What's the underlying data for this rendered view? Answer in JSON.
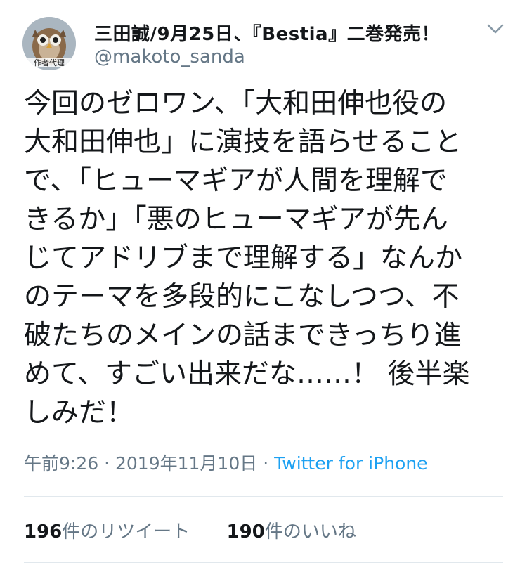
{
  "tweet": {
    "display_name": "三田誠/9月25日、『Bestia』二巻発売！",
    "handle": "@makoto_sanda",
    "avatar_caption": "作者代理",
    "text": "今回のゼロワン、「大和田伸也役の\n大和田伸也」に演技を語らせること\nで、「ヒューマギアが人間を理解で\nきるか」「悪のヒューマギアが先ん\nじてアドリブまで理解する」なんか\nのテーマを多段的にこなしつつ、不\n破たちのメインの話まできっちり進\nめて、すごい出来だな……！ 後半楽\nしみだ！",
    "time": "午前9:26",
    "separator": "·",
    "date": "2019年11月10日",
    "source": "Twitter for iPhone",
    "retweets": {
      "count": "196",
      "label": "件のリツイート"
    },
    "likes": {
      "count": "190",
      "label": "件のいいね"
    }
  },
  "icons": {
    "menu": "chevron-down-icon",
    "avatar": "owl-avatar"
  },
  "colors": {
    "text": "#14171a",
    "secondary": "#657786",
    "link": "#1da1f2",
    "divider": "#e1e8ed"
  }
}
